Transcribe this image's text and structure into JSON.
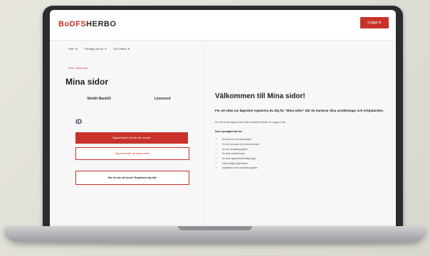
{
  "header": {
    "logo_part1": "BoDFS",
    "logo_part2": "HERBO",
    "login_button": "Logga in"
  },
  "nav": {
    "items": [
      "Hem",
      "Företag och nu",
      "Om Herbo"
    ]
  },
  "breadcrumb": "Hem > Mina sidor",
  "page_title": "Mina sidor",
  "tabs": [
    "Mobilt BankID",
    "Lösenord"
  ],
  "bankid_logo": "iD",
  "buttons": {
    "primary": "Öppna BankID på den här enheten",
    "secondary": "Öppna BankID på annan enhet",
    "register": "Har du inte ett konto? Registrera dig här!"
  },
  "content": {
    "welcome": "Välkommen till Mina sidor!",
    "lead": "För att söka om lägenhet registrera du dig för “Mina sidor” där du hanterar dina ansökningar och erbjudanden.",
    "body": "För att se hyresgäst-/köer eller kontrakt behöver du logga in här.",
    "list_title": "Som hyresgäst kan du:",
    "list": [
      "Anmäla fel och felanmälan",
      "Se din hyresavi och dina kontrakt",
      "Se din kontaktuppgifter",
      "Se dina ansökningar",
      "Se dina lägenhetsförfrågningar",
      "Söka lediga lägenheter",
      "Uppdatera dina kontaktuppgifter"
    ]
  },
  "colors": {
    "brand_red": "#c8322a"
  }
}
